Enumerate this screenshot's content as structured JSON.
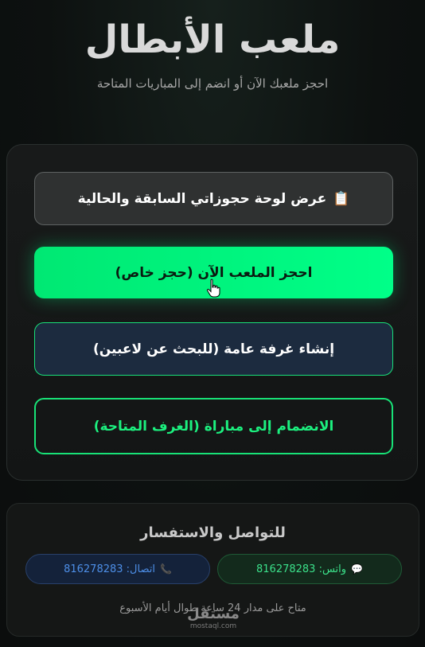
{
  "header": {
    "title": "ملعب الأبطال",
    "subtitle": "احجز ملعبك الآن أو انضم إلى المباريات المتاحة"
  },
  "actions": {
    "history": {
      "icon": "clipboard-icon",
      "icon_glyph": "📋",
      "label": "عرض لوحة حجوزاتي السابقة والحالية"
    },
    "book_private": {
      "label": "احجز الملعب الآن (حجز خاص)"
    },
    "create_public": {
      "label": "إنشاء غرفة عامة (للبحث عن لاعبين)"
    },
    "join_match": {
      "label": "الانضمام إلى مباراة (الغرف المتاحة)"
    }
  },
  "contact": {
    "title": "للتواصل والاستفسار",
    "whatsapp": {
      "icon": "chat-icon",
      "icon_glyph": "💬",
      "label": "واتس: 816278283"
    },
    "call": {
      "icon": "phone-icon",
      "icon_glyph": "📞",
      "label": "اتصال: 816278283"
    },
    "availability": "متاح على مدار 24 ساعة طوال أيام الأسبوع"
  },
  "watermark": {
    "arabic": "مستقل",
    "latin": "mostaql.com"
  },
  "colors": {
    "accent_green": "#00ff88",
    "public_room_bg": "#1c2b3f",
    "whatsapp_text": "#3be08a",
    "call_text": "#4d8fe8"
  }
}
